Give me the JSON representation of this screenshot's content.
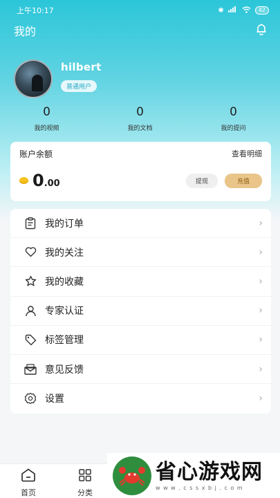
{
  "status_bar": {
    "time": "上午10:17",
    "battery": "42"
  },
  "header": {
    "title": "我的"
  },
  "profile": {
    "username": "hilbert",
    "badge": "普通用户"
  },
  "stats": [
    {
      "value": "0",
      "label": "我的视频"
    },
    {
      "value": "0",
      "label": "我的文档"
    },
    {
      "value": "0",
      "label": "我的提问"
    }
  ],
  "balance": {
    "title": "账户余额",
    "detail_link": "查看明细",
    "amount_int": "0",
    "amount_dec": ".00",
    "withdraw_label": "提现",
    "recharge_label": "充值"
  },
  "menu": {
    "items": [
      {
        "label": "我的订单",
        "icon": "clipboard-icon"
      },
      {
        "label": "我的关注",
        "icon": "heart-icon"
      },
      {
        "label": "我的收藏",
        "icon": "star-icon"
      },
      {
        "label": "专家认证",
        "icon": "user-icon"
      },
      {
        "label": "标签管理",
        "icon": "tag-icon"
      },
      {
        "label": "意见反馈",
        "icon": "envelope-icon"
      },
      {
        "label": "设置",
        "icon": "gear-icon"
      }
    ]
  },
  "tabbar": {
    "items": [
      {
        "label": "首页",
        "icon": "home-icon"
      },
      {
        "label": "分类",
        "icon": "grid-icon"
      }
    ]
  },
  "watermark": {
    "text": "省心游戏网",
    "url": "w w w . c s s x b j . c o m"
  },
  "colors": {
    "accent": "#2bc6d9",
    "coin": "#f7c21f",
    "recharge": "#e9c589"
  }
}
